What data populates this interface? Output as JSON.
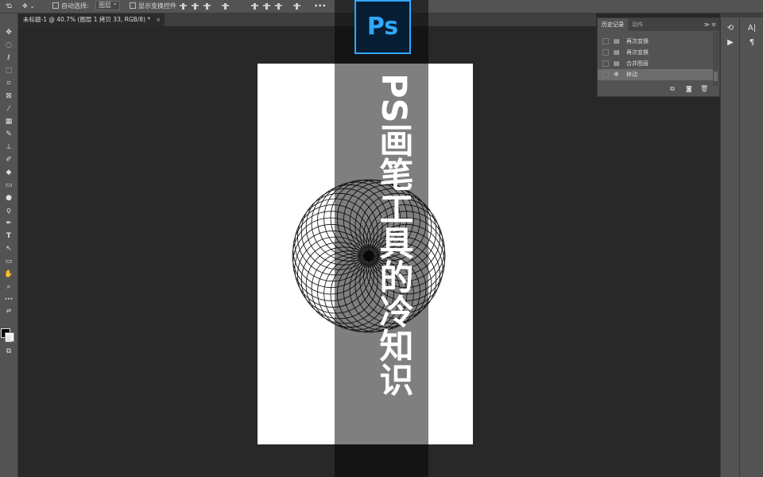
{
  "optionbar": {
    "auto_select_label": "自动选择:",
    "auto_select_value": "图层",
    "show_transform_label": "显示变换控件",
    "more_label": "•••"
  },
  "document": {
    "tab_title": "未标题-1 @ 40.7% (图层 1 拷贝 33, RGB/8) *",
    "close_glyph": "×"
  },
  "overlay": {
    "logo_text": "Ps",
    "title": "PS画笔工具的冷知识"
  },
  "history_panel": {
    "tab_history": "历史记录",
    "tab_actions": "动作",
    "controls": "≫  ≡",
    "items": [
      {
        "label": "再次变换",
        "selected": false
      },
      {
        "label": "再次变换",
        "selected": false
      },
      {
        "label": "合并图层",
        "selected": false
      },
      {
        "label": "移动",
        "selected": true
      }
    ]
  },
  "side_icons": {
    "char_label": "A|",
    "para_label": "¶"
  },
  "colors": {
    "ps_blue": "#31a8ff",
    "ps_dark": "#061e33",
    "ui_panel": "#535353",
    "workspace": "#282828"
  },
  "icons": [
    "home-icon",
    "move-icon",
    "marquee-icon",
    "lasso-icon",
    "quick-select-icon",
    "crop-icon",
    "frame-icon",
    "eyedropper-icon",
    "healing-icon",
    "brush-icon",
    "stamp-icon",
    "history-brush-icon",
    "eraser-icon",
    "gradient-icon",
    "blur-icon",
    "dodge-icon",
    "pen-icon",
    "type-icon",
    "path-select-icon",
    "rectangle-icon",
    "hand-icon",
    "zoom-icon"
  ]
}
